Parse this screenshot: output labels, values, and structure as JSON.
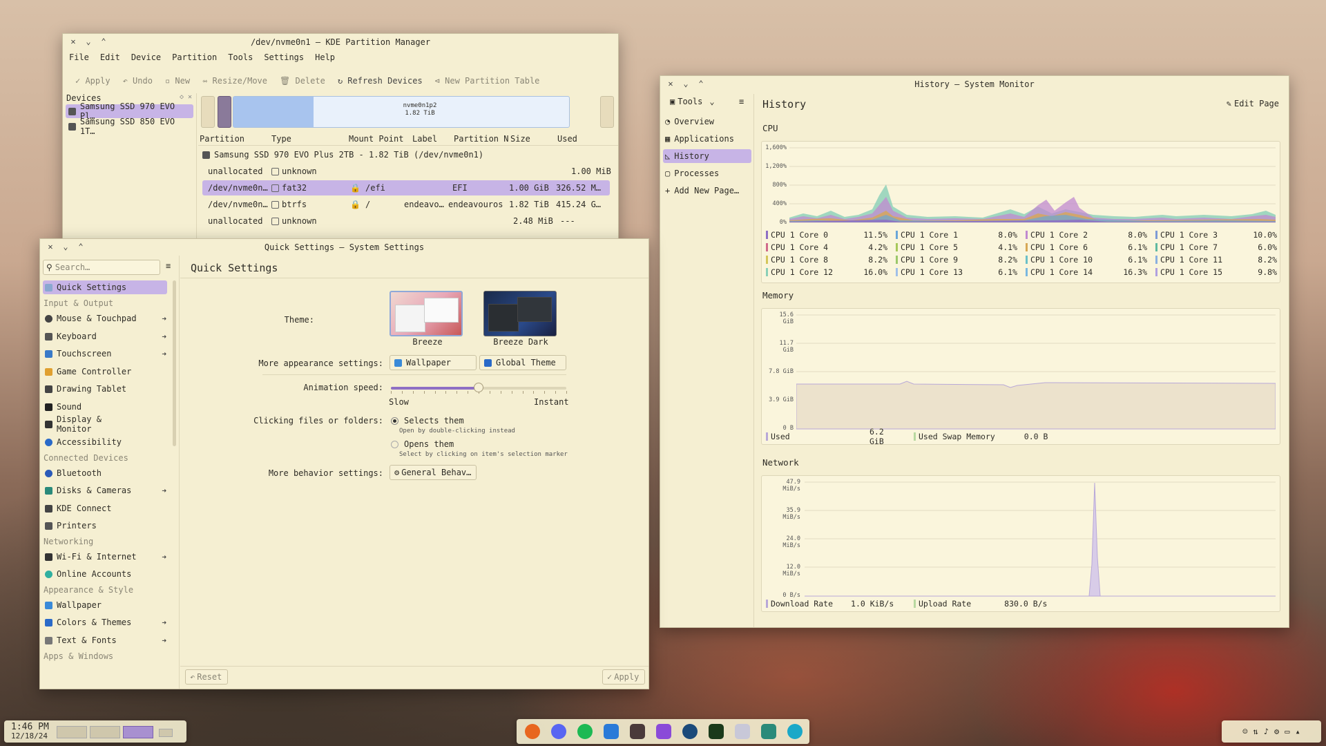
{
  "partition_manager": {
    "title": "/dev/nvme0n1 — KDE Partition Manager",
    "menu": [
      "File",
      "Edit",
      "Device",
      "Partition",
      "Tools",
      "Settings",
      "Help"
    ],
    "toolbar": {
      "apply": "Apply",
      "undo": "Undo",
      "new": "New",
      "resize": "Resize/Move",
      "delete": "Delete",
      "refresh": "Refresh Devices",
      "new_table": "New Partition Table"
    },
    "devices_header": "Devices",
    "devices": [
      "Samsung SSD 970 EVO Pl…",
      "Samsung SSD 850 EVO 1T…"
    ],
    "bar_label": "nvme0n1p2",
    "bar_size": "1.82 TiB",
    "columns": [
      "Partition",
      "Type",
      "Mount Point",
      "Label",
      "Partition N",
      "Size",
      "Used"
    ],
    "disk_row": "Samsung SSD 970 EVO Plus 2TB - 1.82 TiB (/dev/nvme0n1)",
    "rows": [
      {
        "partition": "unallocated",
        "type": "unknown",
        "mount": "",
        "label": "",
        "pname": "",
        "size": "1.00 MiB",
        "used": "---"
      },
      {
        "partition": "/dev/nvme0n…",
        "type": "fat32",
        "mount": "/efi",
        "label": "",
        "pname": "EFI",
        "size": "1.00 GiB",
        "used": "326.52 M…"
      },
      {
        "partition": "/dev/nvme0n…",
        "type": "btrfs",
        "mount": "/",
        "label": "endeavo…",
        "pname": "endeavouros",
        "size": "1.82 TiB",
        "used": "415.24 G…"
      },
      {
        "partition": "unallocated",
        "type": "unknown",
        "mount": "",
        "label": "",
        "pname": "",
        "size": "2.48 MiB",
        "used": "---"
      }
    ]
  },
  "system_settings": {
    "title": "Quick Settings — System Settings",
    "search_placeholder": "Search…",
    "page_title": "Quick Settings",
    "sidebar": {
      "quick": "Quick Settings",
      "sec_input": "Input & Output",
      "mouse": "Mouse & Touchpad",
      "keyboard": "Keyboard",
      "touchscreen": "Touchscreen",
      "game": "Game Controller",
      "drawing": "Drawing Tablet",
      "sound": "Sound",
      "display": "Display & Monitor",
      "access": "Accessibility",
      "sec_connected": "Connected Devices",
      "bluetooth": "Bluetooth",
      "disks": "Disks & Cameras",
      "kdeconnect": "KDE Connect",
      "printers": "Printers",
      "sec_network": "Networking",
      "wifi": "Wi-Fi & Internet",
      "online": "Online Accounts",
      "sec_appearance": "Appearance & Style",
      "wallpaper": "Wallpaper",
      "colors": "Colors & Themes",
      "text": "Text & Fonts",
      "sec_apps": "Apps & Windows"
    },
    "theme_label": "Theme:",
    "theme1": "Breeze",
    "theme2": "Breeze Dark",
    "more_appearance": "More appearance settings:",
    "wallpaper_btn": "Wallpaper",
    "global_theme_btn": "Global Theme",
    "anim_label": "Animation speed:",
    "slow": "Slow",
    "instant": "Instant",
    "animation_speed_fraction": 0.5,
    "click_label": "Clicking files or folders:",
    "opt1": "Selects them",
    "opt1_sub": "Open by double-clicking instead",
    "opt2": "Opens them",
    "opt2_sub": "Select by clicking on item's selection marker",
    "more_behavior": "More behavior settings:",
    "general_btn": "General Behav…",
    "reset": "Reset",
    "apply": "Apply"
  },
  "system_monitor": {
    "title": "History — System Monitor",
    "tools": "Tools",
    "page_title": "History",
    "edit_page": "Edit Page",
    "nav": [
      "Overview",
      "Applications",
      "History",
      "Processes",
      "Add New Page…"
    ],
    "cpu_title": "CPU",
    "memory_title": "Memory",
    "network_title": "Network",
    "cpu_axis": [
      "1,600%",
      "1,200%",
      "800%",
      "400%",
      "0%"
    ],
    "mem_axis": [
      "15.6 GiB",
      "11.7 GiB",
      "7.8 GiB",
      "3.9 GiB",
      "0 B"
    ],
    "net_axis": [
      "47.9 MiB/s",
      "35.9 MiB/s",
      "24.0 MiB/s",
      "12.0 MiB/s",
      "0 B/s"
    ],
    "cores": [
      {
        "name": "CPU 1 Core 0",
        "val": "11.5%",
        "color": "#8e6fc4"
      },
      {
        "name": "CPU 1 Core 1",
        "val": "8.0%",
        "color": "#6aa6d8"
      },
      {
        "name": "CPU 1 Core 2",
        "val": "8.0%",
        "color": "#c08ad0"
      },
      {
        "name": "CPU 1 Core 3",
        "val": "10.0%",
        "color": "#7d9bd6"
      },
      {
        "name": "CPU 1 Core 4",
        "val": "4.2%",
        "color": "#d06a8a"
      },
      {
        "name": "CPU 1 Core 5",
        "val": "4.1%",
        "color": "#a7c85a"
      },
      {
        "name": "CPU 1 Core 6",
        "val": "6.1%",
        "color": "#d7a855"
      },
      {
        "name": "CPU 1 Core 7",
        "val": "6.0%",
        "color": "#5fb9a0"
      },
      {
        "name": "CPU 1 Core 8",
        "val": "8.2%",
        "color": "#d4c65a"
      },
      {
        "name": "CPU 1 Core 9",
        "val": "8.2%",
        "color": "#9bc86a"
      },
      {
        "name": "CPU 1 Core 10",
        "val": "6.1%",
        "color": "#6ac0c8"
      },
      {
        "name": "CPU 1 Core 11",
        "val": "8.2%",
        "color": "#8ab0e0"
      },
      {
        "name": "CPU 1 Core 12",
        "val": "16.0%",
        "color": "#8ad0b8"
      },
      {
        "name": "CPU 1 Core 13",
        "val": "6.1%",
        "color": "#a0c0e8"
      },
      {
        "name": "CPU 1 Core 14",
        "val": "16.3%",
        "color": "#7ab8e0"
      },
      {
        "name": "CPU 1 Core 15",
        "val": "9.8%",
        "color": "#b0a0e0"
      }
    ],
    "mem_used_label": "Used",
    "mem_used": "6.2 GiB",
    "swap_label": "Used Swap Memory",
    "swap": "0.0 B",
    "dl_label": "Download Rate",
    "dl": "1.0 KiB/s",
    "ul_label": "Upload Rate",
    "ul": "830.0 B/s"
  },
  "taskbar": {
    "time": "1:46 PM",
    "date": "12/18/24"
  }
}
